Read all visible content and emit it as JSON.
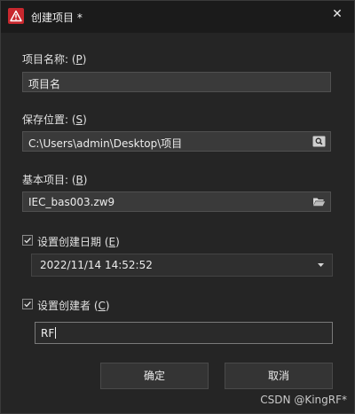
{
  "window": {
    "title": "创建项目 *",
    "close_glyph": "✕",
    "app_icon": "warning-triangle-icon",
    "accent_color": "#c8282e"
  },
  "project_name": {
    "label": "项目名称: (",
    "accel": "P",
    "label_end": ")",
    "value": "项目名"
  },
  "save_location": {
    "label": "保存位置: (",
    "accel": "S",
    "label_end": ")",
    "value": "C:\\Users\\admin\\Desktop\\项目",
    "button_icon": "search-icon"
  },
  "base_project": {
    "label": "基本项目: (",
    "accel": "B",
    "label_end": ")",
    "value": "IEC_bas003.zw9",
    "button_icon": "folder-open-icon"
  },
  "creation_date": {
    "checked": true,
    "label": "设置创建日期 (",
    "accel": "E",
    "label_end": ")",
    "value": "2022/11/14 14:52:52"
  },
  "creator": {
    "checked": true,
    "label": "设置创建者 (",
    "accel": "C",
    "label_end": ")",
    "value": "RF"
  },
  "buttons": {
    "ok": "确定",
    "cancel": "取消"
  },
  "watermark": "CSDN @KingRF*"
}
